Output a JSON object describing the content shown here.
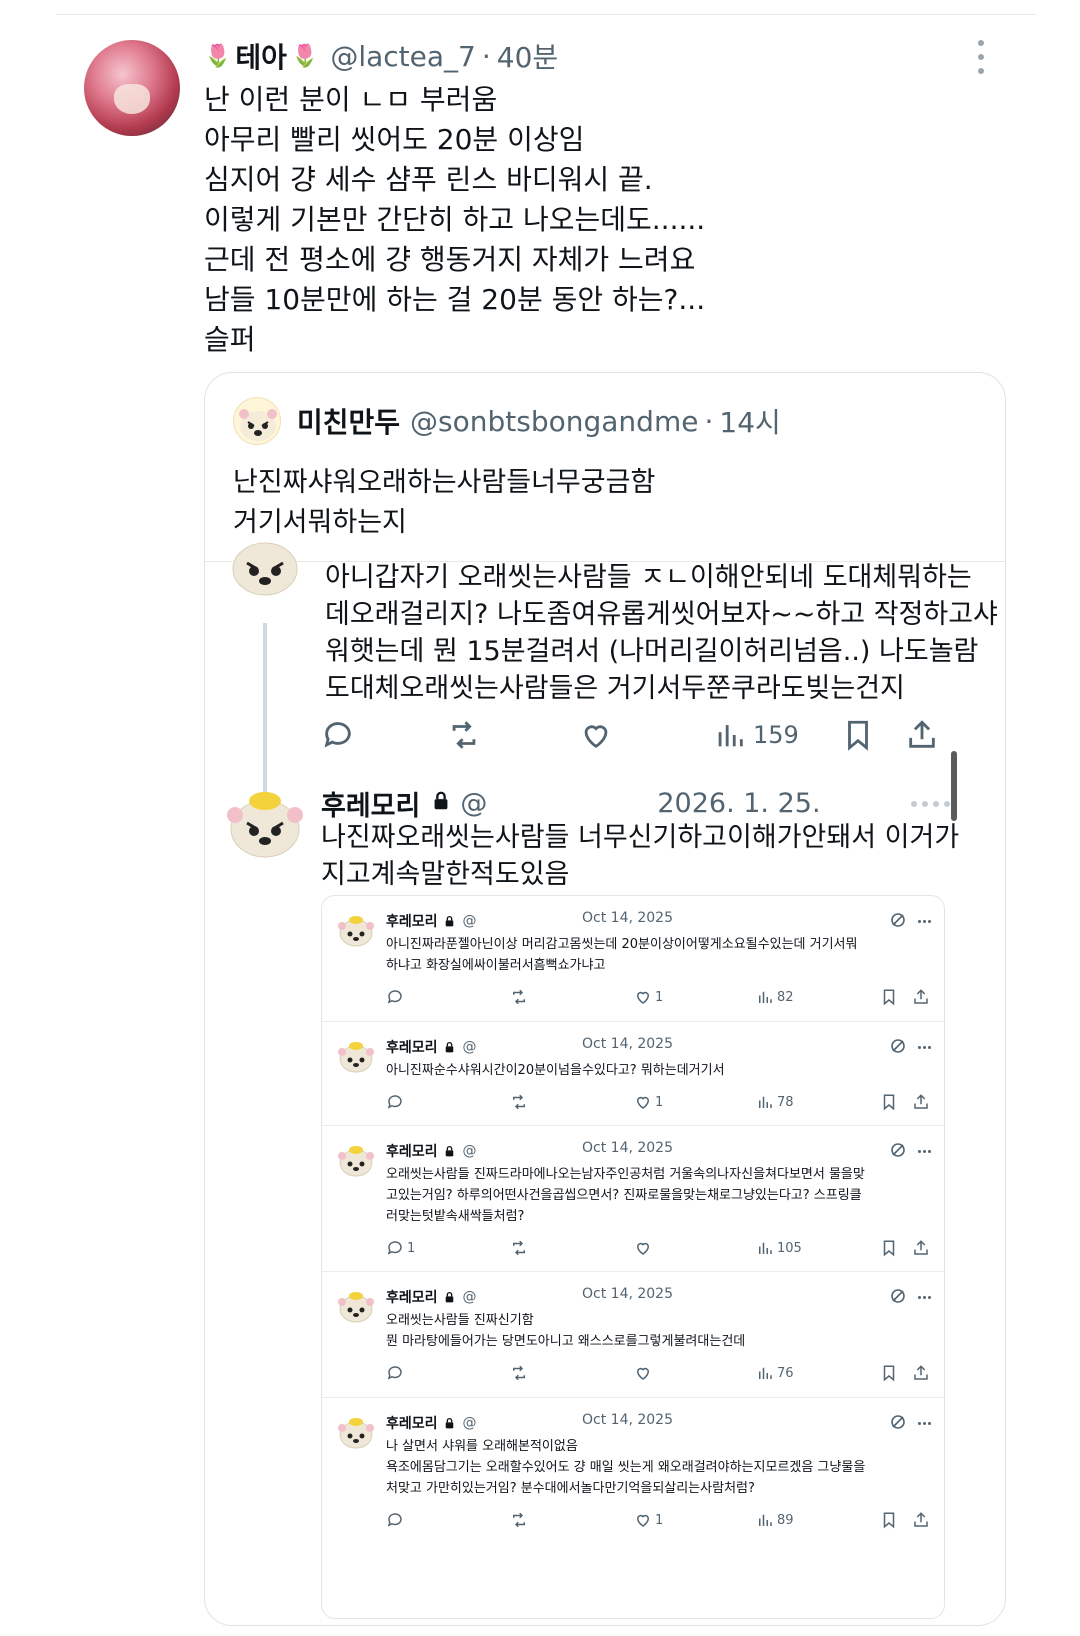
{
  "main_tweet": {
    "display_name": "테아",
    "handle": "@lactea_7",
    "time": "40분",
    "lines": [
      "난 이런 분이 ㄴㅁ 부러움",
      "아무리 빨리 씻어도 20분 이상임",
      "심지어 걍 세수 샴푸 린스 바디워시 끝.",
      "이렇게 기본만 간단히 하고 나오는데도......",
      "근데 전 평소에 걍 행동거지 자체가 느려요",
      "남들 10분만에 하는 걸 20분 동안 하는?...",
      "슬퍼"
    ],
    "icons": {
      "name_decoration": "tulip-icon",
      "menu": "more-vertical-icon"
    }
  },
  "quoted_tweet": {
    "display_name": "미친만두",
    "handle": "@sonbtsbongandme",
    "time": "14시",
    "lines": [
      "난진짜샤워오래하는사람들너무궁금함",
      "거기서뭐하는지"
    ]
  },
  "reply_1": {
    "lines": [
      "아니갑자기 오래씻는사람들 ㅈㄴ이해안되네 도대체뭐하는",
      "데오래걸리지? 나도좀여유롭게씻어보자~~하고 작정하고샤",
      "워햇는데 뭔 15분걸려서 (나머리길이허리넘음..) 나도놀람",
      "도대체오래씻는사람들은 거기서두쭌쿠라도빚는건지"
    ],
    "actions": {
      "views": "159"
    }
  },
  "reply_2": {
    "display_name": "후레모리",
    "at": "@",
    "date": "2026. 1. 25.",
    "lines": [
      "나진짜오래씻는사람들 너무신기하고이해가안돼서 이거가",
      "지고계속말한적도있음"
    ]
  },
  "embedded_tweets": [
    {
      "name": "후레모리",
      "at": "@",
      "date": "Oct 14, 2025",
      "lines": [
        "아니진짜라푼젤아닌이상 머리감고몸씻는데 20분이상이어떻게소요될수있는데 거기서뭐",
        "하냐고 화장실에싸이불러서흠뻑쇼가냐고"
      ],
      "replies": "",
      "likes": "1",
      "views": "82"
    },
    {
      "name": "후레모리",
      "at": "@",
      "date": "Oct 14, 2025",
      "lines": [
        "아니진짜순수샤워시간이20분이넘을수있다고? 뭐하는데거기서"
      ],
      "replies": "",
      "likes": "1",
      "views": "78"
    },
    {
      "name": "후레모리",
      "at": "@",
      "date": "Oct 14, 2025",
      "lines": [
        "오래씻는사람들 진짜드라마에나오는남자주인공처럼 거울속의나자신을쳐다보면서 물을맞",
        "고있는거임? 하루의어떤사건을곱씹으면서? 진짜로물을맞는채로그냥있는다고? 스프링클",
        "러맞는텃밭속새싹들처럼?"
      ],
      "replies": "1",
      "likes": "",
      "views": "105"
    },
    {
      "name": "후레모리",
      "at": "@",
      "date": "Oct 14, 2025",
      "lines": [
        "오래씻는사람들 진짜신기함",
        "뭔 마라탕에들어가는 당면도아니고 왜스스로를그렇게불려대는건데"
      ],
      "replies": "",
      "likes": "",
      "views": "76"
    },
    {
      "name": "후레모리",
      "at": "@",
      "date": "Oct 14, 2025",
      "lines": [
        "나 살면서 샤워를 오래해본적이없음",
        "욕조에몸담그기는 오래할수있어도 걍 매일 씻는게 왜오래걸려야하는지모르겠음 그냥물을",
        "처맞고 가만히있는거임? 분수대에서놀다만기억을되살리는사람처럼?"
      ],
      "replies": "",
      "likes": "1",
      "views": "89"
    }
  ]
}
